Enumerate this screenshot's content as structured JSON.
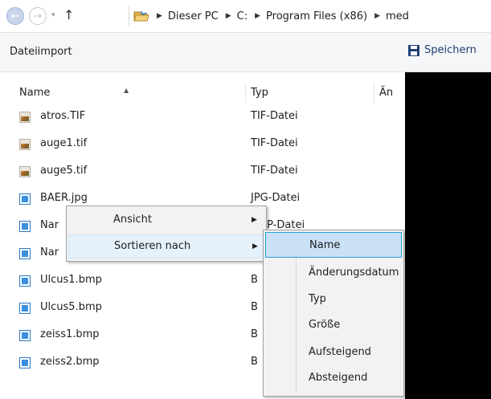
{
  "address_bar": {
    "back_glyph": "←",
    "forward_glyph": "→",
    "recent_glyph": "▾",
    "up_glyph": "↑",
    "separator": "▶",
    "breadcrumbs": [
      "Dieser PC",
      "C:",
      "Program Files (x86)",
      "med"
    ]
  },
  "command_bar": {
    "title": "Dateiimport",
    "save_label": "Speichern"
  },
  "columns": {
    "name": "Name",
    "sort_indicator": "▲",
    "type": "Typ",
    "date": "Än"
  },
  "files": [
    {
      "name": "atros.TIF",
      "type": "TIF-Datei",
      "icon": "tif-file-icon"
    },
    {
      "name": "auge1.tif",
      "type": "TIF-Datei",
      "icon": "tif-file-icon"
    },
    {
      "name": "auge5.tif",
      "type": "TIF-Datei",
      "icon": "tif-file-icon"
    },
    {
      "name": "BAER.jpg",
      "type": "JPG-Datei",
      "icon": "image-file-icon"
    },
    {
      "name": "Nar",
      "type": "BMP-Datei",
      "icon": "image-file-icon"
    },
    {
      "name": "Nar",
      "type": "",
      "icon": "image-file-icon"
    },
    {
      "name": "Ulcus1.bmp",
      "type": "B",
      "icon": "image-file-icon"
    },
    {
      "name": "Ulcus5.bmp",
      "type": "B",
      "icon": "image-file-icon"
    },
    {
      "name": "zeiss1.bmp",
      "type": "B",
      "icon": "image-file-icon"
    },
    {
      "name": "zeiss2.bmp",
      "type": "B",
      "icon": "image-file-icon"
    }
  ],
  "context_menu": {
    "items": [
      {
        "label": "Ansicht",
        "arrow": "▶"
      },
      {
        "label": "Sortieren nach",
        "arrow": "▶"
      }
    ]
  },
  "sort_submenu": {
    "items": [
      {
        "label": "Name"
      },
      {
        "label": "Änderungsdatum"
      },
      {
        "label": "Typ"
      },
      {
        "label": "Größe"
      },
      {
        "label": "Aufsteigend"
      },
      {
        "label": "Absteigend"
      }
    ]
  },
  "colors": {
    "highlight": "#c9e0f7",
    "highlight_border": "#26a0da",
    "menu_bg": "#f2f2f2",
    "save_blue": "#1e3e73"
  }
}
